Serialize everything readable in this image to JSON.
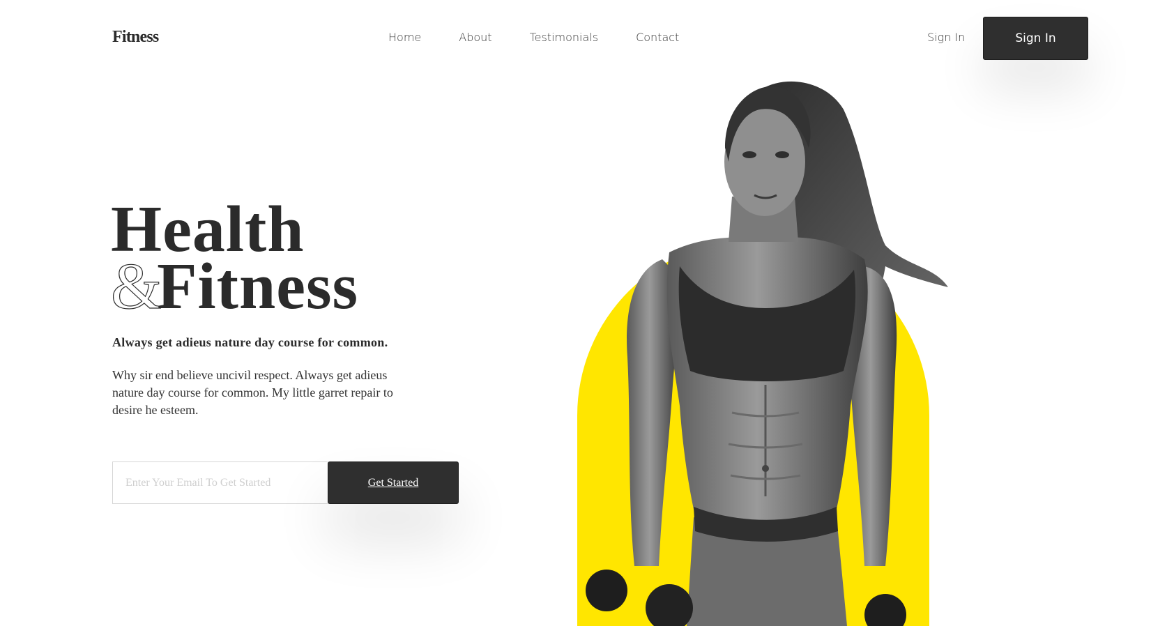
{
  "header": {
    "logo": "Fitness",
    "nav": [
      "Home",
      "About",
      "Testimonials",
      "Contact"
    ],
    "signin_link": "Sign In",
    "signin_button": "Sign In"
  },
  "hero": {
    "title_line1": "Health",
    "ampersand": "&",
    "title_line2": "Fitness",
    "tagline": "Always get adieus nature day course for common.",
    "description": "Why sir end believe uncivil respect. Always get adieus nature day course for common. My little garret repair to desire he esteem.",
    "email_placeholder": "Enter Your Email To Get Started",
    "cta": "Get Started"
  },
  "colors": {
    "accent": "#ffe600",
    "dark": "#2f2f2f"
  }
}
